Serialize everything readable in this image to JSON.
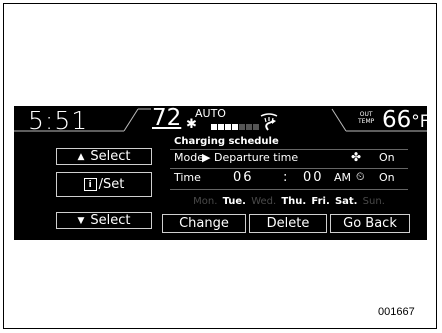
{
  "status_bar": {
    "clock": "5:51",
    "set_temp": "72",
    "mode": "AUTO",
    "fan_level": 4,
    "fan_max": 7,
    "outside_label_1": "OUT",
    "outside_label_2": "TEMP",
    "outside_temp": "66",
    "outside_unit": "°F"
  },
  "left_buttons": {
    "select_up": "Select",
    "info_set": "/Set",
    "select_down": "Select"
  },
  "schedule": {
    "title": "Charging schedule",
    "mode_key": "Mode",
    "mode_value": "Departure time",
    "mode_on": "On",
    "time_key": "Time",
    "hour": "06",
    "colon": ":",
    "minute": "00",
    "ampm": "AM",
    "time_on": "On",
    "days": [
      {
        "label": "Mon.",
        "active": false
      },
      {
        "label": "Tue.",
        "active": true
      },
      {
        "label": "Wed.",
        "active": false
      },
      {
        "label": "Thu.",
        "active": true
      },
      {
        "label": "Fri.",
        "active": true
      },
      {
        "label": "Sat.",
        "active": true
      },
      {
        "label": "Sun.",
        "active": false
      }
    ]
  },
  "actions": {
    "change": "Change",
    "delete": "Delete",
    "go_back": "Go Back"
  },
  "figure_code": "001667"
}
